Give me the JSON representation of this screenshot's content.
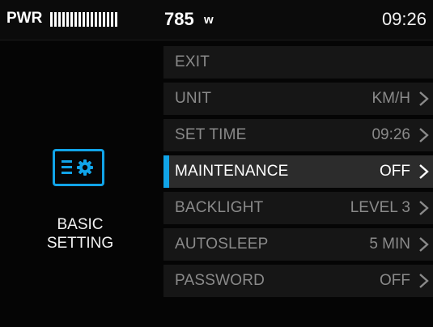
{
  "status": {
    "pwr_label": "PWR",
    "pwr_level": 0.64,
    "pwr_value": "785",
    "pwr_unit": "w",
    "clock": "09:26"
  },
  "category": {
    "icon": "settings-card-icon",
    "label_line1": "BASIC",
    "label_line2": "SETTING",
    "accent": "#11a4e8"
  },
  "menu": {
    "items": [
      {
        "label": "EXIT",
        "value": ""
      },
      {
        "label": "UNIT",
        "value": "KM/H"
      },
      {
        "label": "SET TIME",
        "value": "09:26"
      },
      {
        "label": "MAINTENANCE",
        "value": "OFF"
      },
      {
        "label": "BACKLIGHT",
        "value": "LEVEL 3"
      },
      {
        "label": "AUTOSLEEP",
        "value": "5 MIN"
      },
      {
        "label": "PASSWORD",
        "value": "OFF"
      }
    ],
    "selected_index": 3
  }
}
